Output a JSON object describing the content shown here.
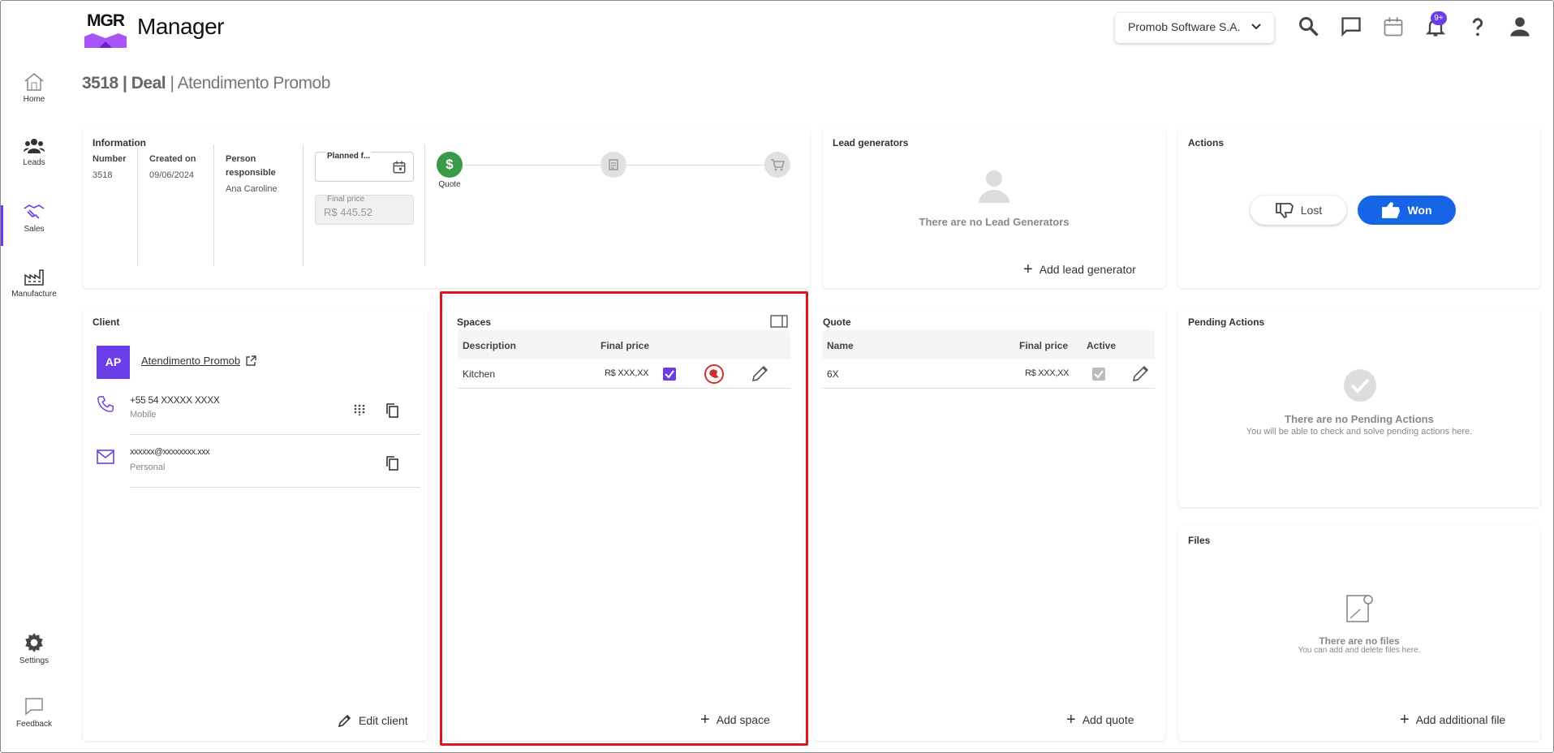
{
  "app": {
    "logo": "MGR",
    "name": "Manager"
  },
  "header": {
    "company": "Promob Software S.A.",
    "notifications_badge": "9+"
  },
  "sidebar": [
    {
      "label": "Home",
      "icon": "home-icon"
    },
    {
      "label": "Leads",
      "icon": "users-icon"
    },
    {
      "label": "Sales",
      "icon": "handshake-icon"
    },
    {
      "label": "Manufacture",
      "icon": "factory-icon"
    },
    {
      "label": "Settings",
      "icon": "gear-icon"
    },
    {
      "label": "Feedback",
      "icon": "feedback-icon"
    }
  ],
  "page": {
    "deal_number": "3518",
    "deal_label": "Deal",
    "deal_name": "Atendimento Promob"
  },
  "information": {
    "title": "Information",
    "number_label": "Number",
    "number": "3518",
    "created_label": "Created on",
    "created": "09/06/2024",
    "person_label": "Person responsible",
    "person": "Ana Caroline",
    "planned_label": "Planned f...",
    "final_price_label": "Final price",
    "final_price": "R$ 445.52",
    "step_quote": "Quote"
  },
  "lead_generators": {
    "title": "Lead generators",
    "empty": "There are no Lead Generators",
    "add": "Add lead generator"
  },
  "actions": {
    "title": "Actions",
    "lost": "Lost",
    "won": "Won"
  },
  "client": {
    "title": "Client",
    "initials": "AP",
    "name": "Atendimento Promob",
    "phone": "+55 54 XXXXX XXXX",
    "phone_type": "Mobile",
    "email": "xxxxxx@xxxxxxxx.xxx",
    "email_type": "Personal",
    "edit": "Edit client"
  },
  "spaces": {
    "title": "Spaces",
    "col_description": "Description",
    "col_price": "Final price",
    "rows": [
      {
        "description": "Kitchen",
        "price": "R$ XXX,XX"
      }
    ],
    "add": "Add space"
  },
  "quote": {
    "title": "Quote",
    "col_name": "Name",
    "col_price": "Final price",
    "col_active": "Active",
    "rows": [
      {
        "name": "6X",
        "price": "R$ XXX,XX"
      }
    ],
    "add": "Add quote"
  },
  "pending": {
    "title": "Pending Actions",
    "empty": "There are no Pending Actions",
    "sub": "You will be able to check and solve pending actions here."
  },
  "files": {
    "title": "Files",
    "empty": "There are no files",
    "sub": "You can add and delete files here.",
    "add": "Add additional file"
  },
  "colors": {
    "accent": "#6a3de8",
    "won": "#1565e6",
    "quote_step": "#3a9a48",
    "highlight": "#e0141e"
  }
}
